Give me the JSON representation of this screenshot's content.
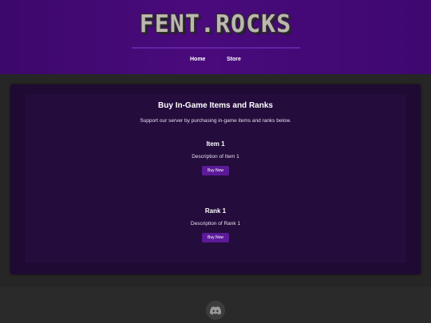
{
  "header": {
    "logo_text": "FENT.ROCKS",
    "nav": [
      {
        "label": "Home"
      },
      {
        "label": "Store"
      }
    ]
  },
  "store": {
    "title": "Buy In-Game Items and Ranks",
    "subtitle": "Support our server by purchasing in-game items and ranks below.",
    "products": [
      {
        "name": "Item 1",
        "description": "Description of Item 1",
        "button": "Buy Now"
      },
      {
        "name": "Rank 1",
        "description": "Description of Rank 1",
        "button": "Buy Now"
      }
    ]
  },
  "footer": {
    "icon": "discord-icon"
  },
  "colors": {
    "header_bg": "#4a0a7c",
    "card_bg": "#240c3c",
    "button_bg": "#5b1a98",
    "page_bg": "#2a2a2a"
  }
}
